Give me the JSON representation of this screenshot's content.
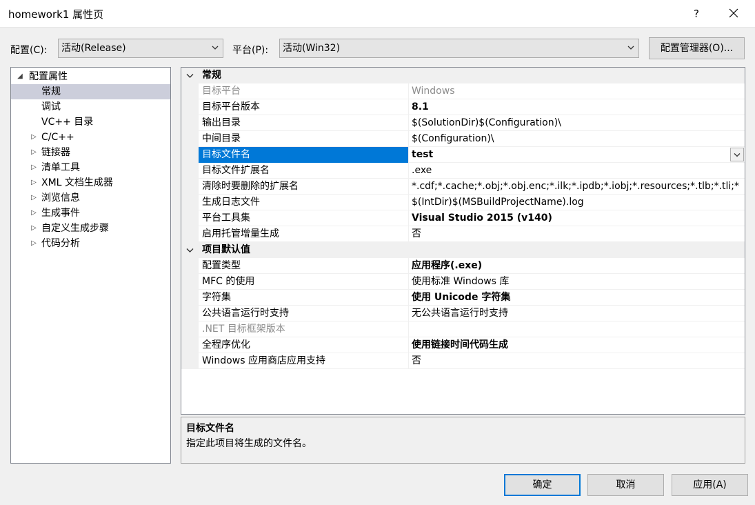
{
  "window": {
    "title": "homework1 属性页",
    "help_label": "?"
  },
  "config": {
    "config_label": "配置(C):",
    "config_value": "活动(Release)",
    "platform_label": "平台(P):",
    "platform_value": "活动(Win32)",
    "manager_label": "配置管理器(O)..."
  },
  "tree": {
    "items": [
      {
        "label": "配置属性",
        "expander": "◢"
      },
      {
        "label": "常规",
        "expander": ""
      },
      {
        "label": "调试",
        "expander": ""
      },
      {
        "label": "VC++ 目录",
        "expander": ""
      },
      {
        "label": "C/C++",
        "expander": "▷"
      },
      {
        "label": "链接器",
        "expander": "▷"
      },
      {
        "label": "清单工具",
        "expander": "▷"
      },
      {
        "label": "XML 文档生成器",
        "expander": "▷"
      },
      {
        "label": "浏览信息",
        "expander": "▷"
      },
      {
        "label": "生成事件",
        "expander": "▷"
      },
      {
        "label": "自定义生成步骤",
        "expander": "▷"
      },
      {
        "label": "代码分析",
        "expander": "▷"
      }
    ]
  },
  "grid": {
    "rows": [
      {
        "name": "常规",
        "value": ""
      },
      {
        "name": "目标平台",
        "value": "Windows"
      },
      {
        "name": "目标平台版本",
        "value": "8.1"
      },
      {
        "name": "输出目录",
        "value": "$(SolutionDir)$(Configuration)\\"
      },
      {
        "name": "中间目录",
        "value": "$(Configuration)\\"
      },
      {
        "name": "目标文件名",
        "value": "test"
      },
      {
        "name": "目标文件扩展名",
        "value": ".exe"
      },
      {
        "name": "清除时要删除的扩展名",
        "value": "*.cdf;*.cache;*.obj;*.obj.enc;*.ilk;*.ipdb;*.iobj;*.resources;*.tlb;*.tli;*"
      },
      {
        "name": "生成日志文件",
        "value": "$(IntDir)$(MSBuildProjectName).log"
      },
      {
        "name": "平台工具集",
        "value": "Visual Studio 2015 (v140)"
      },
      {
        "name": "启用托管增量生成",
        "value": "否"
      },
      {
        "name": "项目默认值",
        "value": ""
      },
      {
        "name": "配置类型",
        "value": "应用程序(.exe)"
      },
      {
        "name": "MFC 的使用",
        "value": "使用标准 Windows 库"
      },
      {
        "name": "字符集",
        "value": "使用 Unicode 字符集"
      },
      {
        "name": "公共语言运行时支持",
        "value": "无公共语言运行时支持"
      },
      {
        "name": ".NET 目标框架版本",
        "value": ""
      },
      {
        "name": "全程序优化",
        "value": "使用链接时间代码生成"
      },
      {
        "name": "Windows 应用商店应用支持",
        "value": "否"
      }
    ]
  },
  "description": {
    "title": "目标文件名",
    "text": "指定此项目将生成的文件名。"
  },
  "buttons": {
    "ok": "确定",
    "cancel": "取消",
    "apply": "应用(A)"
  },
  "colors": {
    "selection": "#0078d7",
    "tree_selection": "#cccedb",
    "dim_text": "#8d8d8d"
  }
}
